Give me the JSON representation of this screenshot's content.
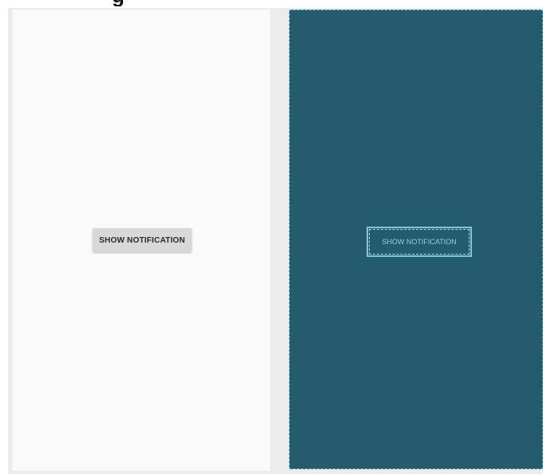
{
  "design_view": {
    "button_label": "SHOW NOTIFICATION",
    "background_color": "#fafafa",
    "button_color": "#d8d8d8"
  },
  "blueprint_view": {
    "button_label": "SHOW NOTIFICATION",
    "background_color": "#245c6d",
    "outline_color": "#7cc7d6"
  }
}
